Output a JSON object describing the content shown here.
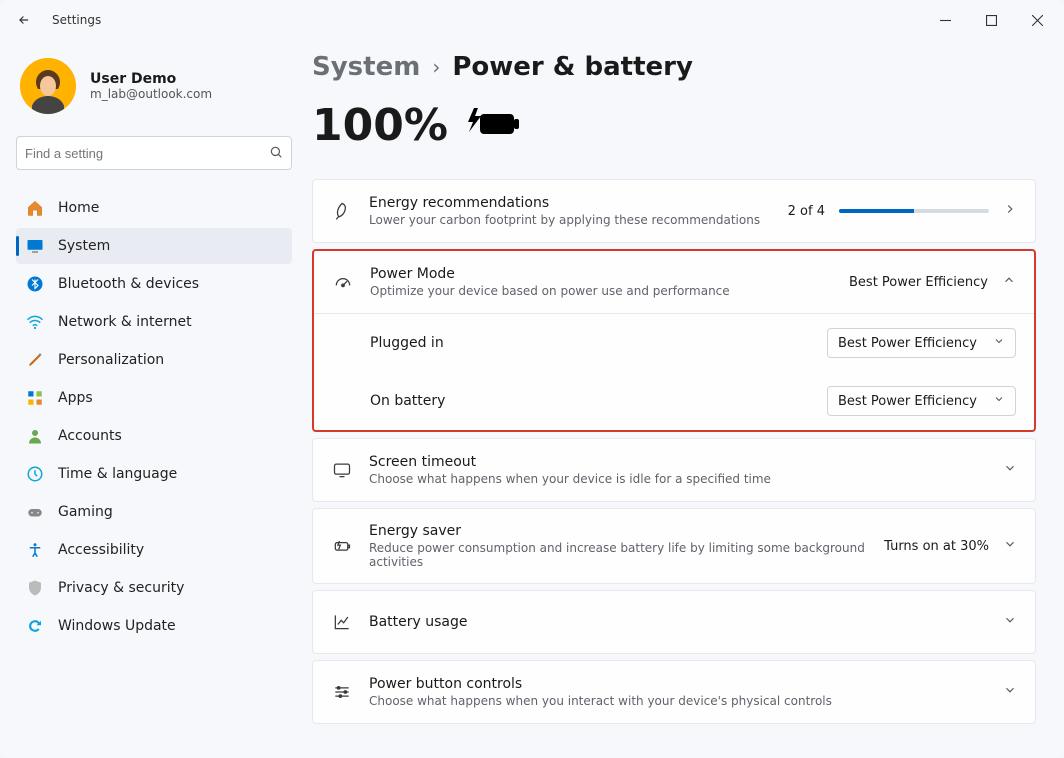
{
  "window": {
    "title": "Settings"
  },
  "profile": {
    "name": "User Demo",
    "email": "m_lab@outlook.com"
  },
  "search": {
    "placeholder": "Find a setting"
  },
  "nav": [
    {
      "key": "home",
      "label": "Home"
    },
    {
      "key": "system",
      "label": "System",
      "active": true
    },
    {
      "key": "bluetooth",
      "label": "Bluetooth & devices"
    },
    {
      "key": "network",
      "label": "Network & internet"
    },
    {
      "key": "personalization",
      "label": "Personalization"
    },
    {
      "key": "apps",
      "label": "Apps"
    },
    {
      "key": "accounts",
      "label": "Accounts"
    },
    {
      "key": "time",
      "label": "Time & language"
    },
    {
      "key": "gaming",
      "label": "Gaming"
    },
    {
      "key": "accessibility",
      "label": "Accessibility"
    },
    {
      "key": "privacy",
      "label": "Privacy & security"
    },
    {
      "key": "update",
      "label": "Windows Update"
    }
  ],
  "breadcrumb": {
    "parent": "System",
    "current": "Power & battery"
  },
  "battery": {
    "percent": "100%"
  },
  "energy_rec": {
    "title": "Energy recommendations",
    "desc": "Lower your carbon footprint by applying these recommendations",
    "progress_label": "2 of 4",
    "progress_pct": 50
  },
  "power_mode": {
    "title": "Power Mode",
    "desc": "Optimize your device based on power use and performance",
    "summary": "Best Power Efficiency",
    "plugged_label": "Plugged in",
    "plugged_value": "Best Power Efficiency",
    "battery_label": "On battery",
    "battery_value": "Best Power Efficiency"
  },
  "screen_timeout": {
    "title": "Screen timeout",
    "desc": "Choose what happens when your device is idle for a specified time"
  },
  "energy_saver": {
    "title": "Energy saver",
    "desc": "Reduce power consumption and increase battery life by limiting some background activities",
    "status": "Turns on at 30%"
  },
  "battery_usage": {
    "title": "Battery usage"
  },
  "power_button": {
    "title": "Power button controls",
    "desc": "Choose what happens when you interact with your device's physical controls"
  }
}
